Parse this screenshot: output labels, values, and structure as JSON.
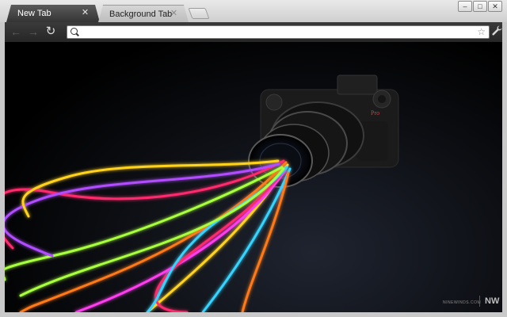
{
  "tabs": [
    {
      "label": "New Tab",
      "close": "✕",
      "active": true
    },
    {
      "label": "Background Tab",
      "close": "✕",
      "active": false
    }
  ],
  "window_controls": {
    "minimize": "–",
    "maximize": "□",
    "close": "✕"
  },
  "toolbar": {
    "back": "←",
    "forward": "→",
    "reload": "↻",
    "omnibox_value": "",
    "star": "☆",
    "wrench": "🔧"
  },
  "wallpaper": {
    "camera_brand": "Pro",
    "watermark_text": "NINEWINDS.COM",
    "watermark_logo": "NW"
  },
  "colors": {
    "light_streaks": [
      "#ff2a6d",
      "#ff7a18",
      "#ffd21f",
      "#a8ff3e",
      "#35d4ff",
      "#b14dff",
      "#ff3df0"
    ]
  }
}
